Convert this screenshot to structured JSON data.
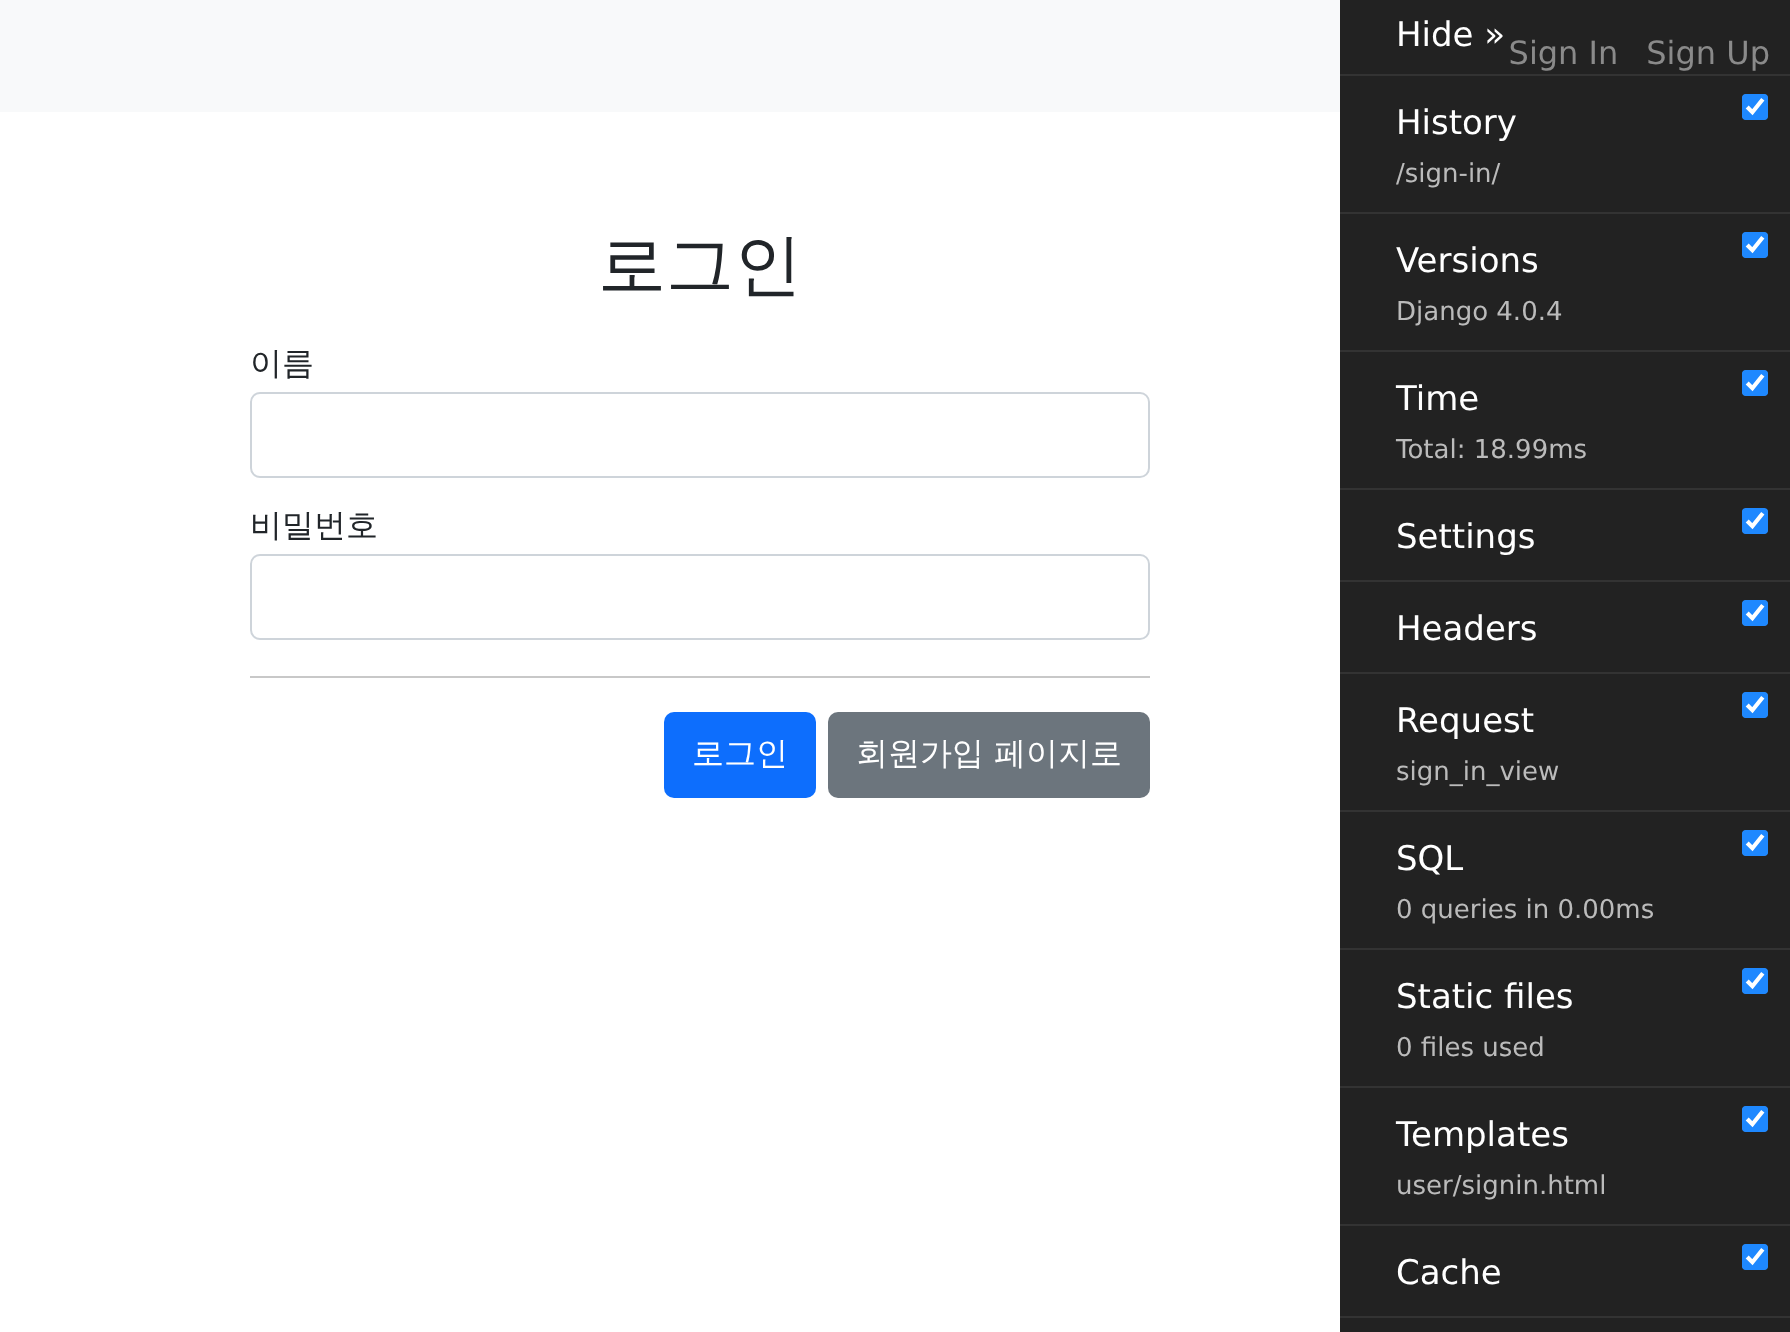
{
  "navbar": {
    "links": [
      "Sign In",
      "Sign Up"
    ]
  },
  "form": {
    "title": "로그인",
    "fields": [
      {
        "label": "이름"
      },
      {
        "label": "비밀번호"
      }
    ],
    "buttons": [
      {
        "label": "로그인",
        "kind": "primary"
      },
      {
        "label": "회원가입 페이지로",
        "kind": "secondary"
      }
    ]
  },
  "debug_toolbar": {
    "hide": "Hide »",
    "panels": [
      {
        "title": "History",
        "subtitle": "/sign-in/",
        "checked": true
      },
      {
        "title": "Versions",
        "subtitle": "Django 4.0.4",
        "checked": true
      },
      {
        "title": "Time",
        "subtitle": "Total: 18.99ms",
        "checked": true
      },
      {
        "title": "Settings",
        "checked": true
      },
      {
        "title": "Headers",
        "checked": true
      },
      {
        "title": "Request",
        "subtitle": "sign_in_view",
        "checked": true
      },
      {
        "title": "SQL",
        "subtitle": "0 queries in 0.00ms",
        "checked": true
      },
      {
        "title": "Static files",
        "subtitle": "0 files used",
        "checked": true
      },
      {
        "title": "Templates",
        "subtitle": "user/signin.html",
        "checked": true
      },
      {
        "title": "Cache",
        "checked": true
      }
    ]
  }
}
